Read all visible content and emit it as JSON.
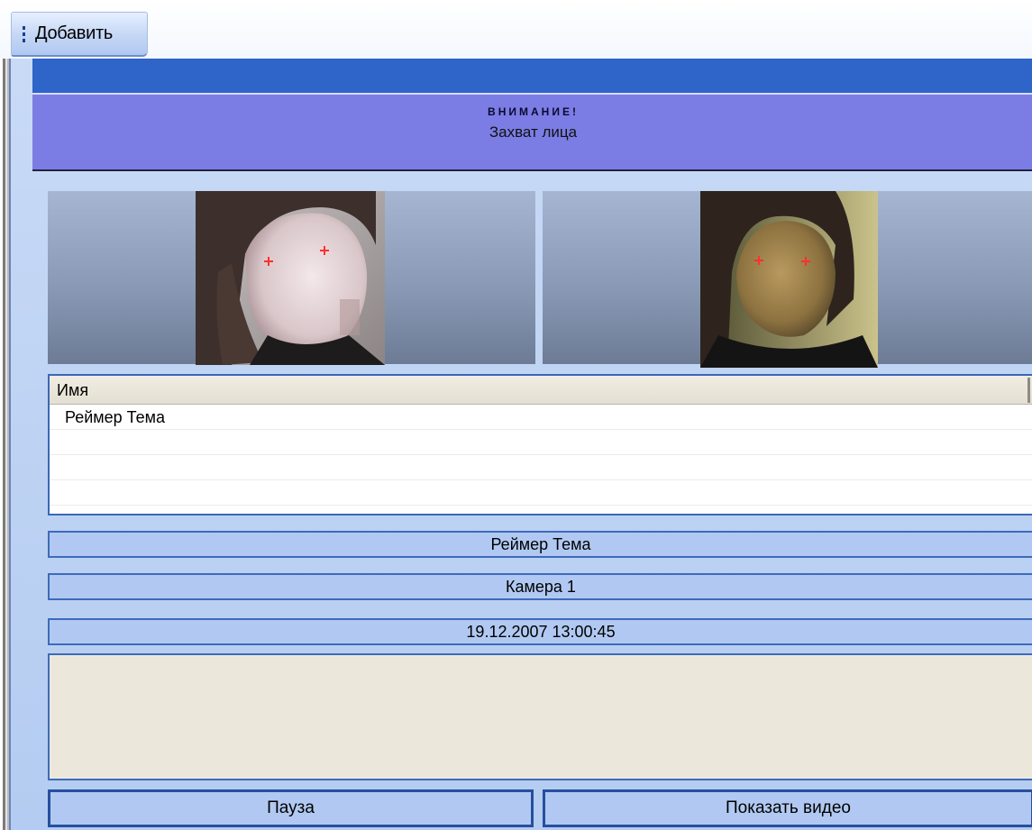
{
  "toolbar": {
    "add_label": "Добавить"
  },
  "alert": {
    "heading": "ВНИМАНИЕ!",
    "subheading": "Захват лица"
  },
  "table": {
    "header": "Имя",
    "rows": [
      "Реймер Тема",
      "",
      "",
      ""
    ]
  },
  "info": {
    "person_name": "Реймер Тема",
    "camera": "Камера 1",
    "datetime": "19.12.2007 13:00:45"
  },
  "buttons": {
    "pause": "Пауза",
    "show_video": "Показать видео"
  },
  "colors": {
    "title_strip": "#2f64c8",
    "alert_bg": "#7b7de4",
    "panel_bg": "#b4ccf1",
    "field_border": "#3d6bba",
    "eye_marker": "#ff3030"
  },
  "icons": [
    "grip-icon",
    "eye-marker-icon"
  ]
}
